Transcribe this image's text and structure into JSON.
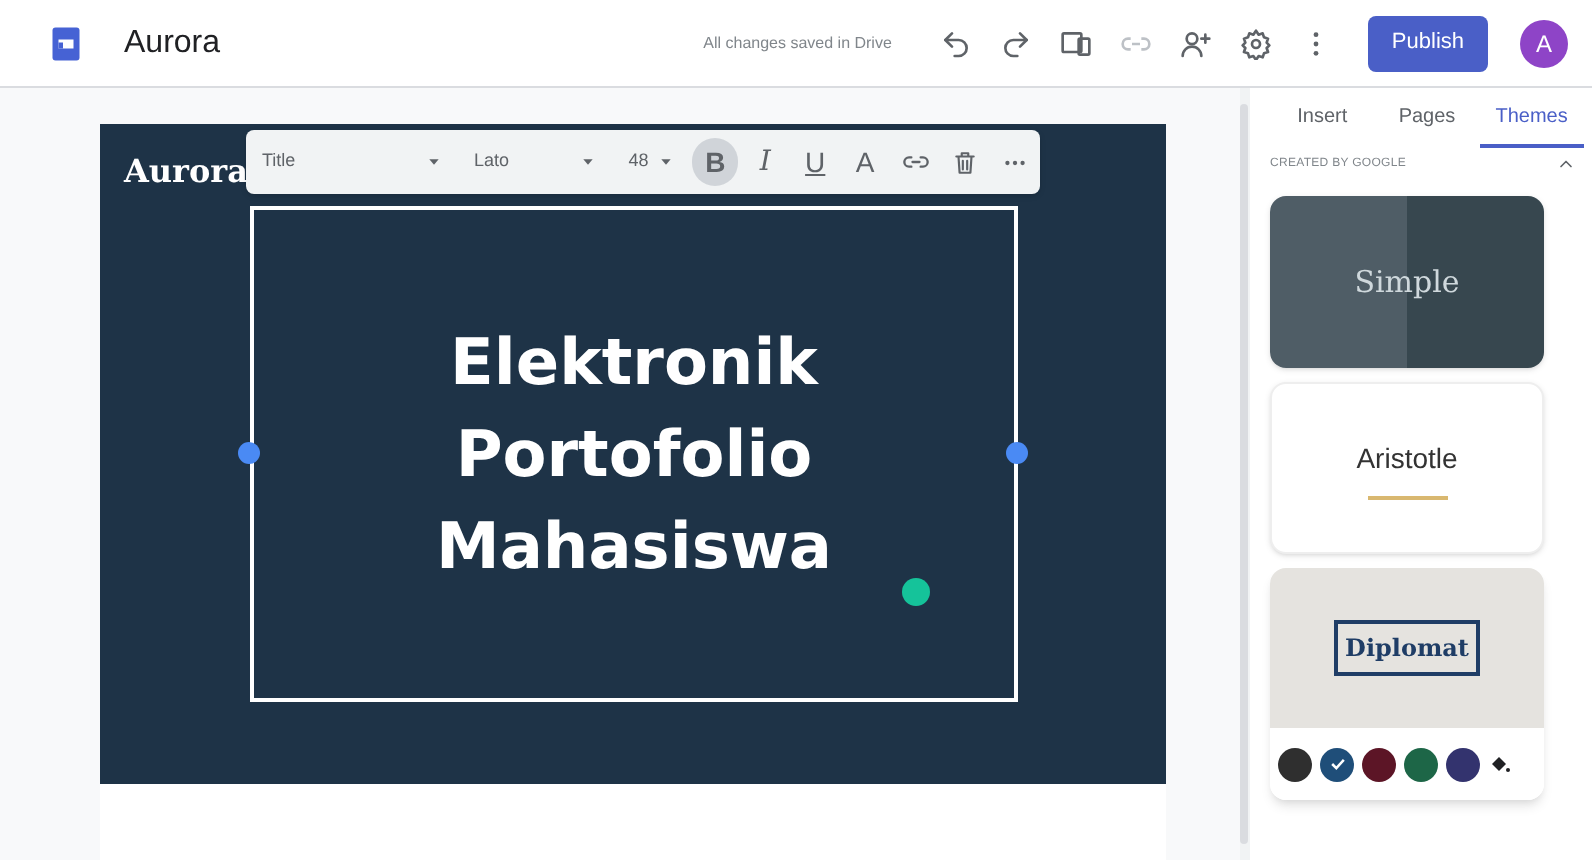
{
  "app_bar": {
    "title": "Aurora",
    "save_status": "All changes saved in Drive",
    "publish": "Publish",
    "avatar": "A"
  },
  "page": {
    "site_name": "Aurora",
    "title_lines": [
      "Elektronik",
      "Portofolio",
      "Mahasiswa"
    ]
  },
  "format_toolbar": {
    "style": "Title",
    "font": "Lato",
    "size": "48",
    "buttons": [
      {
        "kind": "bold",
        "label": "B",
        "selected": true
      },
      {
        "kind": "italic",
        "label": "I",
        "selected": false
      },
      {
        "kind": "underline",
        "label": "U",
        "selected": false
      },
      {
        "kind": "color",
        "label": "A",
        "selected": false
      },
      {
        "kind": "link",
        "selected": false
      },
      {
        "kind": "delete",
        "selected": false
      },
      {
        "kind": "more",
        "selected": false
      }
    ]
  },
  "side_panel": {
    "tabs": [
      {
        "label": "Insert",
        "selected": false
      },
      {
        "label": "Pages",
        "selected": false
      },
      {
        "label": "Themes",
        "selected": true
      }
    ],
    "section": "CREATED BY GOOGLE",
    "expanded": true,
    "themes": [
      {
        "kind": "simple",
        "name": "Simple",
        "selected": false
      },
      {
        "kind": "aristotle",
        "name": "Aristotle",
        "selected": false
      },
      {
        "kind": "diplomat",
        "name": "Diplomat",
        "selected": true,
        "swatches": [
          {
            "color": "#2f2f2f",
            "checked": false
          },
          {
            "color": "#1f4e79",
            "checked": true
          },
          {
            "color": "#5c1526",
            "checked": false
          },
          {
            "color": "#1d6647",
            "checked": false
          },
          {
            "color": "#33336e",
            "checked": false
          }
        ]
      }
    ]
  }
}
